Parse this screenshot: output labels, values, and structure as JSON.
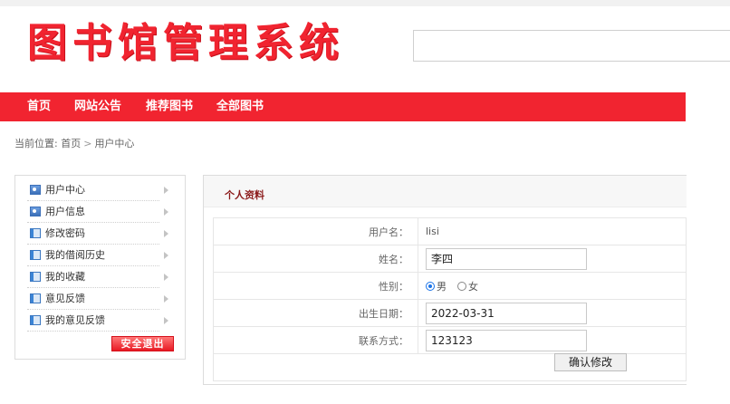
{
  "header": {
    "logo_text": "图书馆管理系统",
    "search_value": ""
  },
  "nav": [
    "首页",
    "网站公告",
    "推荐图书",
    "全部图书"
  ],
  "breadcrumb": {
    "prefix": "当前位置:",
    "home": "首页",
    "separator": ">",
    "current": "用户中心"
  },
  "sidebar": {
    "items": [
      {
        "label": "用户中心",
        "icon": "user-card-icon"
      },
      {
        "label": "用户信息",
        "icon": "user-card-icon"
      },
      {
        "label": "修改密码",
        "icon": "document-icon"
      },
      {
        "label": "我的借阅历史",
        "icon": "document-icon"
      },
      {
        "label": "我的收藏",
        "icon": "document-icon"
      },
      {
        "label": "意见反馈",
        "icon": "document-icon"
      },
      {
        "label": "我的意见反馈",
        "icon": "document-icon"
      }
    ],
    "logout_label": "安全退出"
  },
  "profile": {
    "title": "个人资料",
    "username_label": "用户名：",
    "username_value": "lisi",
    "name_label": "姓名：",
    "name_value": "李四",
    "gender_label": "性别：",
    "gender_options": [
      "男",
      "女"
    ],
    "gender_selected": "男",
    "birthday_label": "出生日期：",
    "birthday_value": "2022-03-31",
    "contact_label": "联系方式：",
    "contact_value": "123123",
    "submit_label": "确认修改"
  },
  "colors": {
    "brand_red": "#f12430",
    "title_text": "#8b1a1a"
  }
}
